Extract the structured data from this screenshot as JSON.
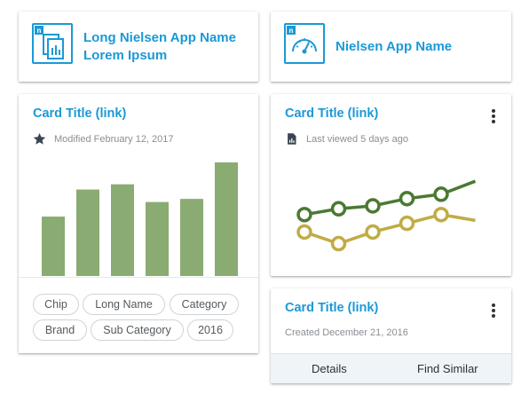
{
  "app_cards": [
    {
      "name_line1": "Long Nielsen App Name",
      "name_line2": "Lorem Ipsum",
      "icon": "document-chart-icon"
    },
    {
      "name": "Nielsen App Name",
      "icon": "gauge-icon"
    }
  ],
  "bar_card": {
    "title": "Card Title (link)",
    "meta": "Modified February 12, 2017",
    "meta_icon": "star-icon",
    "chart_data": {
      "type": "bar",
      "categories": [
        "",
        "",
        "",
        "",
        "",
        ""
      ],
      "values": [
        57,
        83,
        88,
        71,
        74,
        109
      ],
      "ylim": [
        0,
        115
      ],
      "color": "#8aab72"
    },
    "chips": [
      "Chip",
      "Long Name",
      "Category",
      "Brand",
      "Sub Category",
      "2016"
    ]
  },
  "line_card": {
    "title": "Card Title (link)",
    "meta": "Last viewed 5 days ago",
    "meta_icon": "document-icon",
    "chart_data": {
      "type": "line",
      "x": [
        1,
        2,
        3,
        4,
        5,
        6
      ],
      "series": [
        {
          "values": [
            57,
            61,
            63,
            68,
            71,
            80
          ],
          "color": "#4a7a31"
        },
        {
          "values": [
            45,
            37,
            45,
            51,
            57,
            53
          ],
          "color": "#c0ac45"
        }
      ],
      "ylim": [
        30,
        85
      ]
    }
  },
  "detail_card": {
    "title": "Card Title (link)",
    "meta": "Created December 21, 2016",
    "actions": [
      "Details",
      "Find Similar"
    ]
  },
  "colors": {
    "accent": "#1a99d6",
    "bar": "#8aab72",
    "line_dark": "#4a7a31",
    "line_gold": "#c0ac45"
  }
}
